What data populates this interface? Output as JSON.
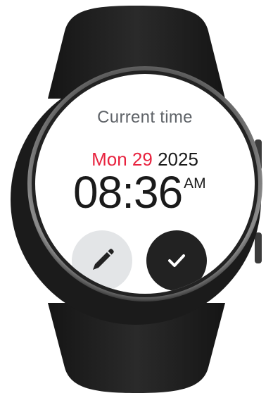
{
  "screen": {
    "title": "Current time",
    "date": {
      "weekday_day": "Mon 29",
      "year": "2025",
      "accent_color": "#e8233f"
    },
    "time": {
      "value": "08:36",
      "period": "AM"
    }
  },
  "actions": {
    "edit": {
      "icon": "pencil-icon",
      "background": "#e3e5e7"
    },
    "confirm": {
      "icon": "checkmark-icon",
      "background": "#222222"
    }
  }
}
